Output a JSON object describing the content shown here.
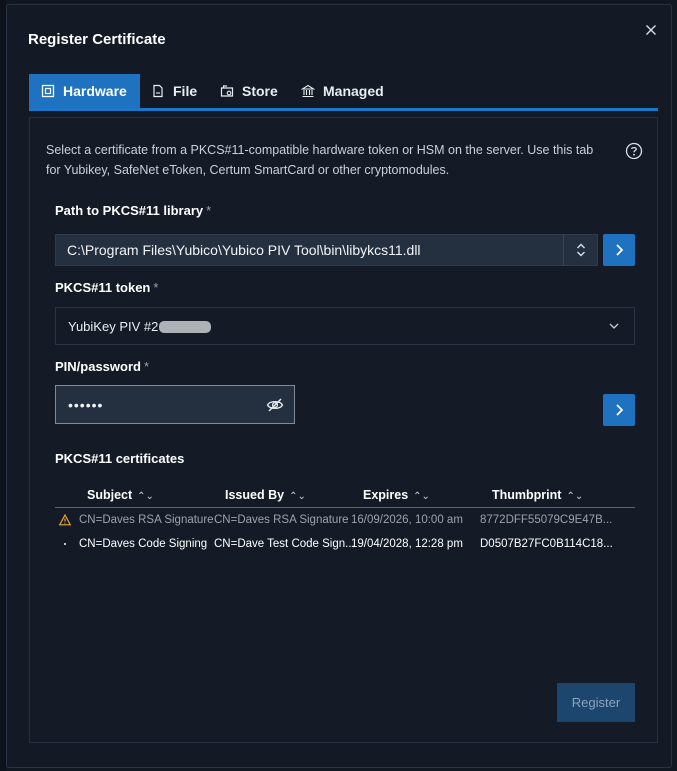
{
  "dialog": {
    "title": "Register Certificate"
  },
  "tabs": [
    {
      "label": "Hardware",
      "icon": "chip-icon",
      "active": true
    },
    {
      "label": "File",
      "icon": "file-icon",
      "active": false
    },
    {
      "label": "Store",
      "icon": "store-icon",
      "active": false
    },
    {
      "label": "Managed",
      "icon": "bank-icon",
      "active": false
    }
  ],
  "hardware": {
    "description": "Select a certificate from a PKCS#11-compatible hardware token or HSM on the server. Use this tab for Yubikey, SafeNet eToken, Certum SmartCard or other cryptomodules.",
    "library_label": "Path to PKCS#11 library",
    "library_value": "C:\\Program Files\\Yubico\\Yubico PIV Tool\\bin\\libykcs11.dll",
    "token_label": "PKCS#11 token",
    "token_value": "YubiKey PIV #2",
    "pin_label": "PIN/password",
    "pin_value": "••••••",
    "required_mark": "*",
    "certs_label": "PKCS#11 certificates"
  },
  "table": {
    "headers": [
      "Subject",
      "Issued By",
      "Expires",
      "Thumbprint"
    ],
    "sort_glyph": "⌃⌄",
    "rows": [
      {
        "marker": "warning-icon",
        "subject": "CN=Daves RSA Signature",
        "issued_by": "CN=Daves RSA Signature",
        "expires": "16/09/2026, 10:00 am",
        "thumbprint": "8772DFF55079C9E47B..."
      },
      {
        "marker": "dot",
        "subject": "CN=Daves Code Signing",
        "issued_by": "CN=Dave Test Code Sign...",
        "expires": "19/04/2028, 12:28 pm",
        "thumbprint": "D0507B27FC0B114C18..."
      }
    ]
  },
  "actions": {
    "register_label": "Register"
  },
  "colors": {
    "accent": "#1f72c0",
    "background": "#131a26",
    "warning": "#e8a33c"
  }
}
